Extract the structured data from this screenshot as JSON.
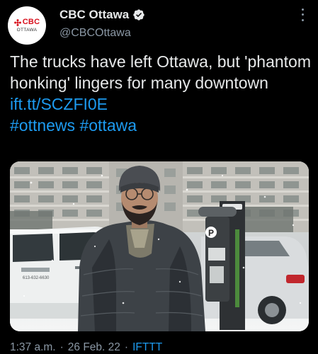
{
  "account": {
    "display_name": "CBC Ottawa",
    "handle": "@CBCOttawa",
    "avatar_brand": "CBC",
    "avatar_city": "OTTAWA",
    "verified": true
  },
  "tweet": {
    "text": "The trucks have left Ottawa, but 'phantom honking' lingers for many downtown ",
    "link": "ift.tt/SCZFI0E",
    "hashtags": [
      "#ottnews",
      "#ottawa"
    ]
  },
  "media": {
    "sign_letter": "P",
    "van_phone": "613-632-6630"
  },
  "meta": {
    "time": "1:37 a.m.",
    "date": "26 Feb. 22",
    "source": "IFTTT",
    "separator": "·"
  },
  "colors": {
    "background": "#000000",
    "text": "#e7e9ea",
    "secondary": "#8b98a5",
    "link": "#1d9bf0",
    "brand_red": "#d8101d"
  }
}
